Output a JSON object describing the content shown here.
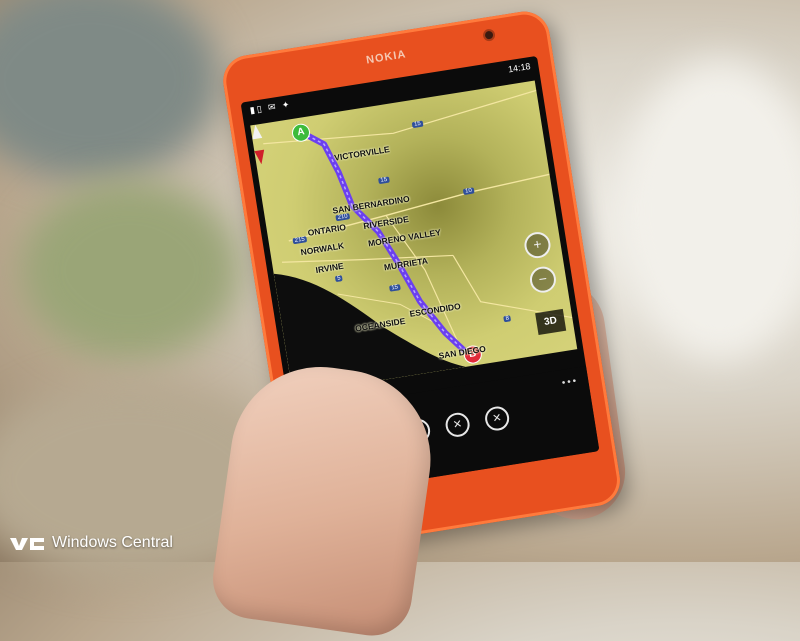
{
  "device": {
    "brand": "NOKIA",
    "status_time": "14:18"
  },
  "map": {
    "cities": [
      {
        "id": "victorville",
        "label": "VICTORVILLE"
      },
      {
        "id": "san-bernardino",
        "label": "SAN BERNARDINO"
      },
      {
        "id": "ontario",
        "label": "ONTARIO"
      },
      {
        "id": "riverside",
        "label": "RIVERSIDE"
      },
      {
        "id": "norwalk",
        "label": "NORWALK"
      },
      {
        "id": "moreno-valley",
        "label": "MORENO VALLEY"
      },
      {
        "id": "irvine",
        "label": "IRVINE"
      },
      {
        "id": "murrieta",
        "label": "MURRIETA"
      },
      {
        "id": "oceanside",
        "label": "OCEANSIDE"
      },
      {
        "id": "escondido",
        "label": "ESCONDIDO"
      },
      {
        "id": "san-diego",
        "label": "SAN DIEGO"
      }
    ],
    "highways": [
      "15",
      "215",
      "210",
      "10",
      "5",
      "15",
      "8",
      "15"
    ],
    "marker_start": "A",
    "marker_end": "B",
    "zoom_in": "+",
    "zoom_out": "−",
    "view_toggle": "3D",
    "route_color": "#6b3ff0"
  },
  "appbar": {
    "more": "•••",
    "buttons": [
      {
        "id": "route",
        "glyph": "⇅"
      },
      {
        "id": "stop",
        "glyph": "■"
      },
      {
        "id": "clear",
        "glyph": "✕"
      },
      {
        "id": "close",
        "glyph": "✕"
      }
    ]
  },
  "watermark": {
    "text": "Windows Central"
  }
}
